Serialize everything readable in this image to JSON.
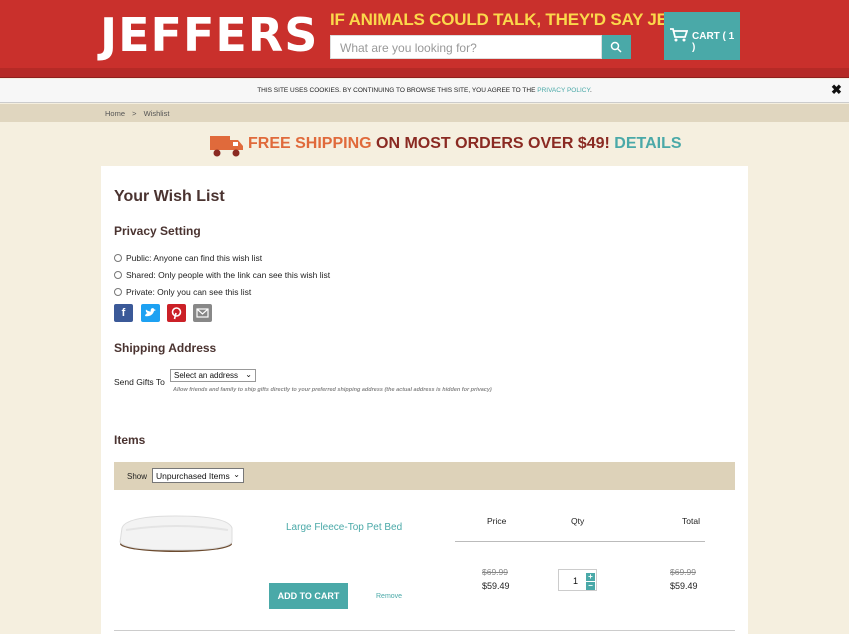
{
  "header": {
    "logo": "JEFFERS",
    "tagline": "IF ANIMALS COULD TALK, THEY'D SAY JEFFERS!",
    "search_placeholder": "What are you looking for?",
    "search_icon": "search-icon",
    "cart_label": "CART ( 1 )",
    "cart_icon": "cart-icon",
    "colors": {
      "brand_red": "#c9302c",
      "accent_teal": "#4aa9a8",
      "tagline_yellow": "#fbd84b"
    }
  },
  "cookie_bar": {
    "text_before": "THIS SITE USES COOKIES. BY CONTINUING TO BROWSE THIS SITE, YOU AGREE TO THE ",
    "link": "PRIVACY POLICY",
    "text_after": ".",
    "close": "✖"
  },
  "breadcrumb": {
    "home": "Home",
    "separator": ">",
    "current": "Wishlist"
  },
  "shipping_banner": {
    "free": "FREE SHIPPING",
    "middle": " ON MOST ORDERS OVER $49! ",
    "details": "DETAILS",
    "icon": "truck-icon"
  },
  "wishlist": {
    "title": "Your Wish List",
    "privacy_heading": "Privacy Setting",
    "privacy_options": [
      "Public: Anyone can find this wish list",
      "Shared: Only people with the link can see this wish list",
      "Private: Only you can see this list"
    ],
    "social": [
      "facebook-icon",
      "twitter-icon",
      "pinterest-icon",
      "email-icon"
    ],
    "shipping_heading": "Shipping Address",
    "send_gifts_label": "Send Gifts To",
    "address_select": "Select an address",
    "address_help": "Allow friends and family to ship gifts directly to your preferred shipping address (the actual address is hidden for privacy)",
    "items_heading": "Items",
    "show_label": "Show",
    "show_select": "Unpurchased Items"
  },
  "items": [
    {
      "name": "Large Fleece-Top Pet Bed",
      "price_old": "$69.99",
      "price_new": "$59.49",
      "qty": "1",
      "total_old": "$69.99",
      "total_new": "$59.49",
      "add_to_cart": "ADD TO CART",
      "remove": "Remove"
    }
  ],
  "columns": {
    "price": "Price",
    "qty": "Qty",
    "total": "Total"
  }
}
